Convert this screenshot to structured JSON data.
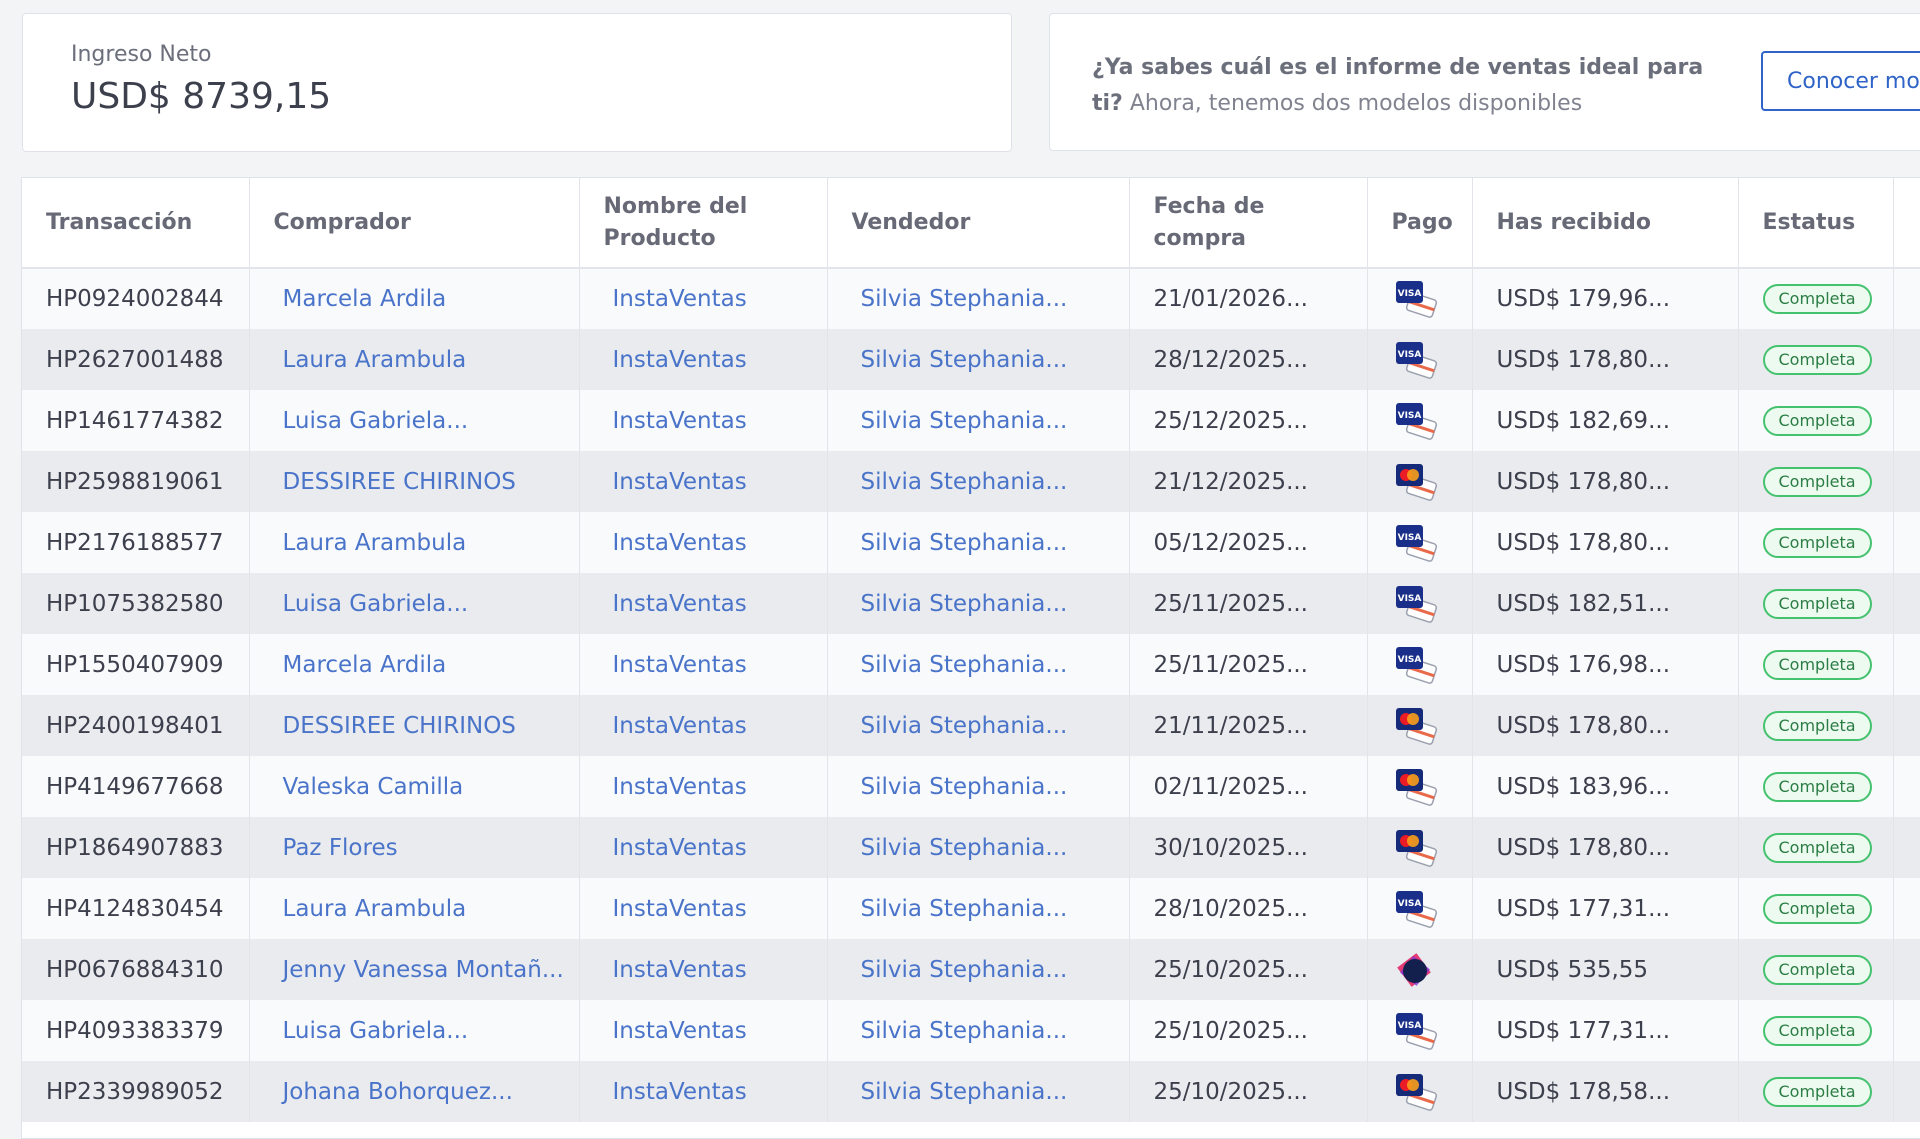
{
  "summary": {
    "income_label": "Ingreso Neto",
    "income_value": "USD$ 8739,15"
  },
  "promo": {
    "bold": "¿Ya sabes cuál es el informe de ventas ideal para ti?",
    "text": " Ahora, tenemos dos modelos disponibles",
    "button": "Conocer mod"
  },
  "columns": [
    "Transacción",
    "Comprador",
    "Nombre del Producto",
    "Vendedor",
    "Fecha de compra",
    "Pago",
    "Has recibido",
    "Estatus"
  ],
  "colors": {
    "link": "#4a74c9",
    "badge_border": "#45c26e",
    "accent": "#2f63c7"
  },
  "rows": [
    {
      "id": "HP0924002844",
      "buyer": "Marcela Ardila",
      "product": "InstaVentas",
      "seller": "Silvia Stephania...",
      "date": "21/01/2026...",
      "payment": "visa",
      "received": "USD$ 179,96...",
      "status": "Completa"
    },
    {
      "id": "HP2627001488",
      "buyer": "Laura Arambula",
      "product": "InstaVentas",
      "seller": "Silvia Stephania...",
      "date": "28/12/2025...",
      "payment": "visa",
      "received": "USD$ 178,80...",
      "status": "Completa"
    },
    {
      "id": "HP1461774382",
      "buyer": "Luisa Gabriela...",
      "product": "InstaVentas",
      "seller": "Silvia Stephania...",
      "date": "25/12/2025...",
      "payment": "visa",
      "received": "USD$ 182,69...",
      "status": "Completa"
    },
    {
      "id": "HP2598819061",
      "buyer": "DESSIREE CHIRINOS",
      "product": "InstaVentas",
      "seller": "Silvia Stephania...",
      "date": "21/12/2025...",
      "payment": "mastercard",
      "received": "USD$ 178,80...",
      "status": "Completa"
    },
    {
      "id": "HP2176188577",
      "buyer": "Laura Arambula",
      "product": "InstaVentas",
      "seller": "Silvia Stephania...",
      "date": "05/12/2025...",
      "payment": "visa",
      "received": "USD$ 178,80...",
      "status": "Completa"
    },
    {
      "id": "HP1075382580",
      "buyer": "Luisa Gabriela...",
      "product": "InstaVentas",
      "seller": "Silvia Stephania...",
      "date": "25/11/2025...",
      "payment": "visa",
      "received": "USD$ 182,51...",
      "status": "Completa"
    },
    {
      "id": "HP1550407909",
      "buyer": "Marcela Ardila",
      "product": "InstaVentas",
      "seller": "Silvia Stephania...",
      "date": "25/11/2025...",
      "payment": "visa",
      "received": "USD$ 176,98...",
      "status": "Completa"
    },
    {
      "id": "HP2400198401",
      "buyer": "DESSIREE CHIRINOS",
      "product": "InstaVentas",
      "seller": "Silvia Stephania...",
      "date": "21/11/2025...",
      "payment": "mastercard",
      "received": "USD$ 178,80...",
      "status": "Completa"
    },
    {
      "id": "HP4149677668",
      "buyer": "Valeska Camilla",
      "product": "InstaVentas",
      "seller": "Silvia Stephania...",
      "date": "02/11/2025...",
      "payment": "mastercard",
      "received": "USD$ 183,96...",
      "status": "Completa"
    },
    {
      "id": "HP1864907883",
      "buyer": "Paz Flores",
      "product": "InstaVentas",
      "seller": "Silvia Stephania...",
      "date": "30/10/2025...",
      "payment": "mastercard",
      "received": "USD$ 178,80...",
      "status": "Completa"
    },
    {
      "id": "HP4124830454",
      "buyer": "Laura Arambula",
      "product": "InstaVentas",
      "seller": "Silvia Stephania...",
      "date": "28/10/2025...",
      "payment": "visa",
      "received": "USD$ 177,31...",
      "status": "Completa"
    },
    {
      "id": "HP0676884310",
      "buyer": "Jenny Vanessa Montañ...",
      "product": "InstaVentas",
      "seller": "Silvia Stephania...",
      "date": "25/10/2025...",
      "payment": "pix",
      "received": "USD$ 535,55",
      "status": "Completa"
    },
    {
      "id": "HP4093383379",
      "buyer": "Luisa Gabriela...",
      "product": "InstaVentas",
      "seller": "Silvia Stephania...",
      "date": "25/10/2025...",
      "payment": "visa",
      "received": "USD$ 177,31...",
      "status": "Completa"
    },
    {
      "id": "HP2339989052",
      "buyer": "Johana Bohorquez...",
      "product": "InstaVentas",
      "seller": "Silvia Stephania...",
      "date": "25/10/2025...",
      "payment": "mastercard",
      "received": "USD$ 178,58...",
      "status": "Completa"
    }
  ]
}
